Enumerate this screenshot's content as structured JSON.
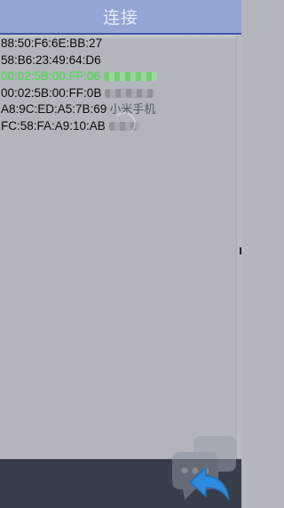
{
  "header": {
    "title": "连接"
  },
  "devices": [
    {
      "mac": "88:50:F6:6E:BB:27",
      "name": "",
      "connected": false
    },
    {
      "mac": "58:B6:23:49:64:D6",
      "name": "",
      "connected": false
    },
    {
      "mac": "00:02:5B:00:FF:06",
      "name": "",
      "connected": true
    },
    {
      "mac": "00:02:5B:00:FF:0B",
      "name": "",
      "connected": false
    },
    {
      "mac": "A8:9C:ED:A5:7B:69",
      "name": "小米手机",
      "connected": false
    },
    {
      "mac": "FC:58:FA:A9:10:AB",
      "name": "",
      "connected": false
    }
  ],
  "colors": {
    "header_bg": "#92a5d4",
    "header_text": "#e4ebf8",
    "connected": "#3ee23e",
    "bottom_bar": "#373d49",
    "back_icon": "#2e8bdc"
  },
  "icons": {
    "back": "back-arrow-icon",
    "watermark": "chat-bubble-icon"
  }
}
